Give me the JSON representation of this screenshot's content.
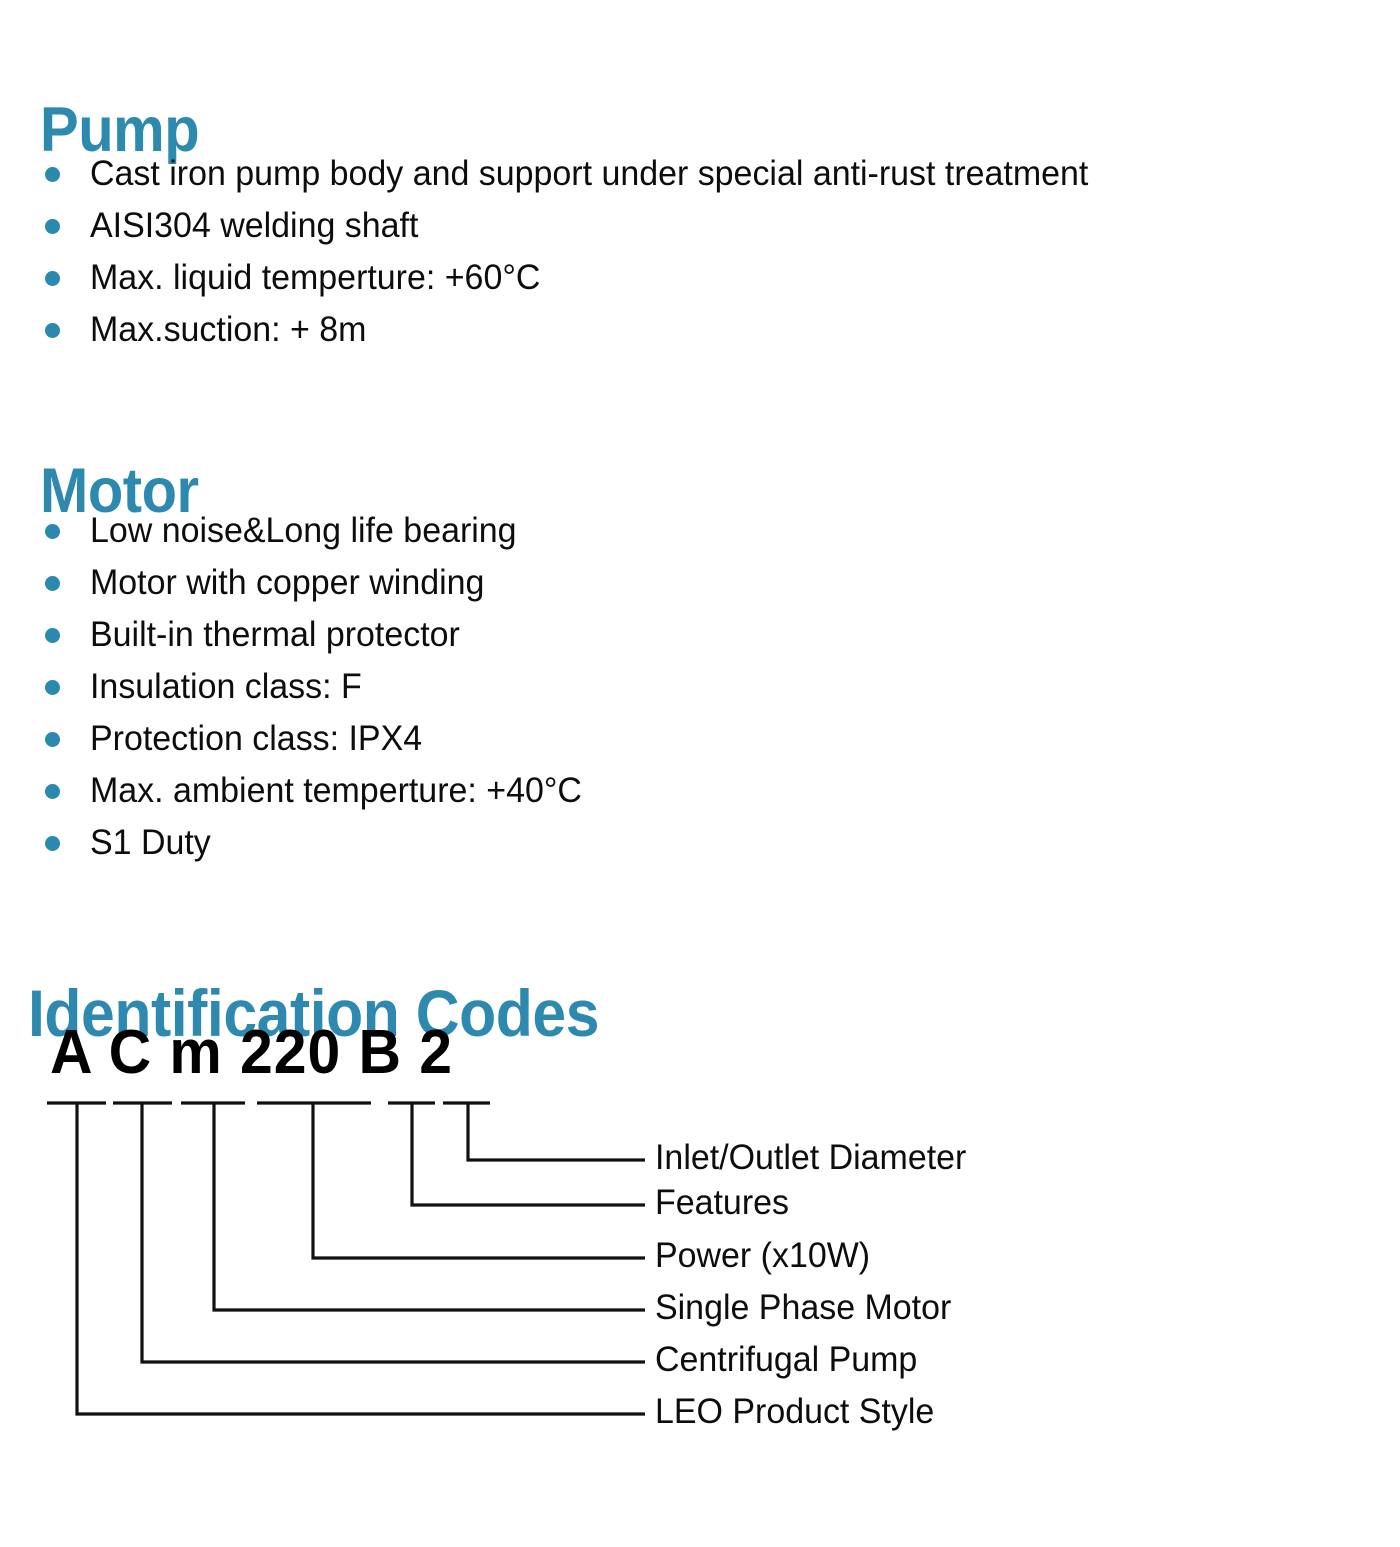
{
  "theme": {
    "heading_color": "#2d89ad",
    "bullet_color": "#2b89ad",
    "text_color": "#0d0d0d",
    "line_color": "#111111",
    "background": "#ffffff"
  },
  "sections": {
    "pump": {
      "heading": "Pump",
      "bullets": [
        "Cast iron pump body and support under special anti-rust treatment",
        "AISI304 welding shaft",
        "Max. liquid temperture: +60°C",
        "Max.suction: + 8m"
      ]
    },
    "motor": {
      "heading": "Motor",
      "bullets": [
        "Low noise&Long life bearing",
        "Motor with copper winding",
        "Built-in thermal protector",
        "Insulation class: F",
        "Protection class: IPX4",
        "Max. ambient temperture: +40°C",
        "S1 Duty"
      ]
    },
    "identification_codes": {
      "heading": "Identification Codes",
      "code": "A C m 220 B 2",
      "segments": [
        {
          "token": "A",
          "label": "LEO Product Style"
        },
        {
          "token": "C",
          "label": "Centrifugal Pump"
        },
        {
          "token": "m",
          "label": "Single Phase Motor"
        },
        {
          "token": "220",
          "label": "Power (x10W)"
        },
        {
          "token": "B",
          "label": "Features"
        },
        {
          "token": "2",
          "label": "Inlet/Outlet Diameter"
        }
      ],
      "labels_top_to_bottom": [
        "Inlet/Outlet Diameter",
        "Features",
        "Power (x10W)",
        "Single Phase Motor",
        "Centrifugal Pump",
        "LEO Product Style"
      ]
    }
  }
}
